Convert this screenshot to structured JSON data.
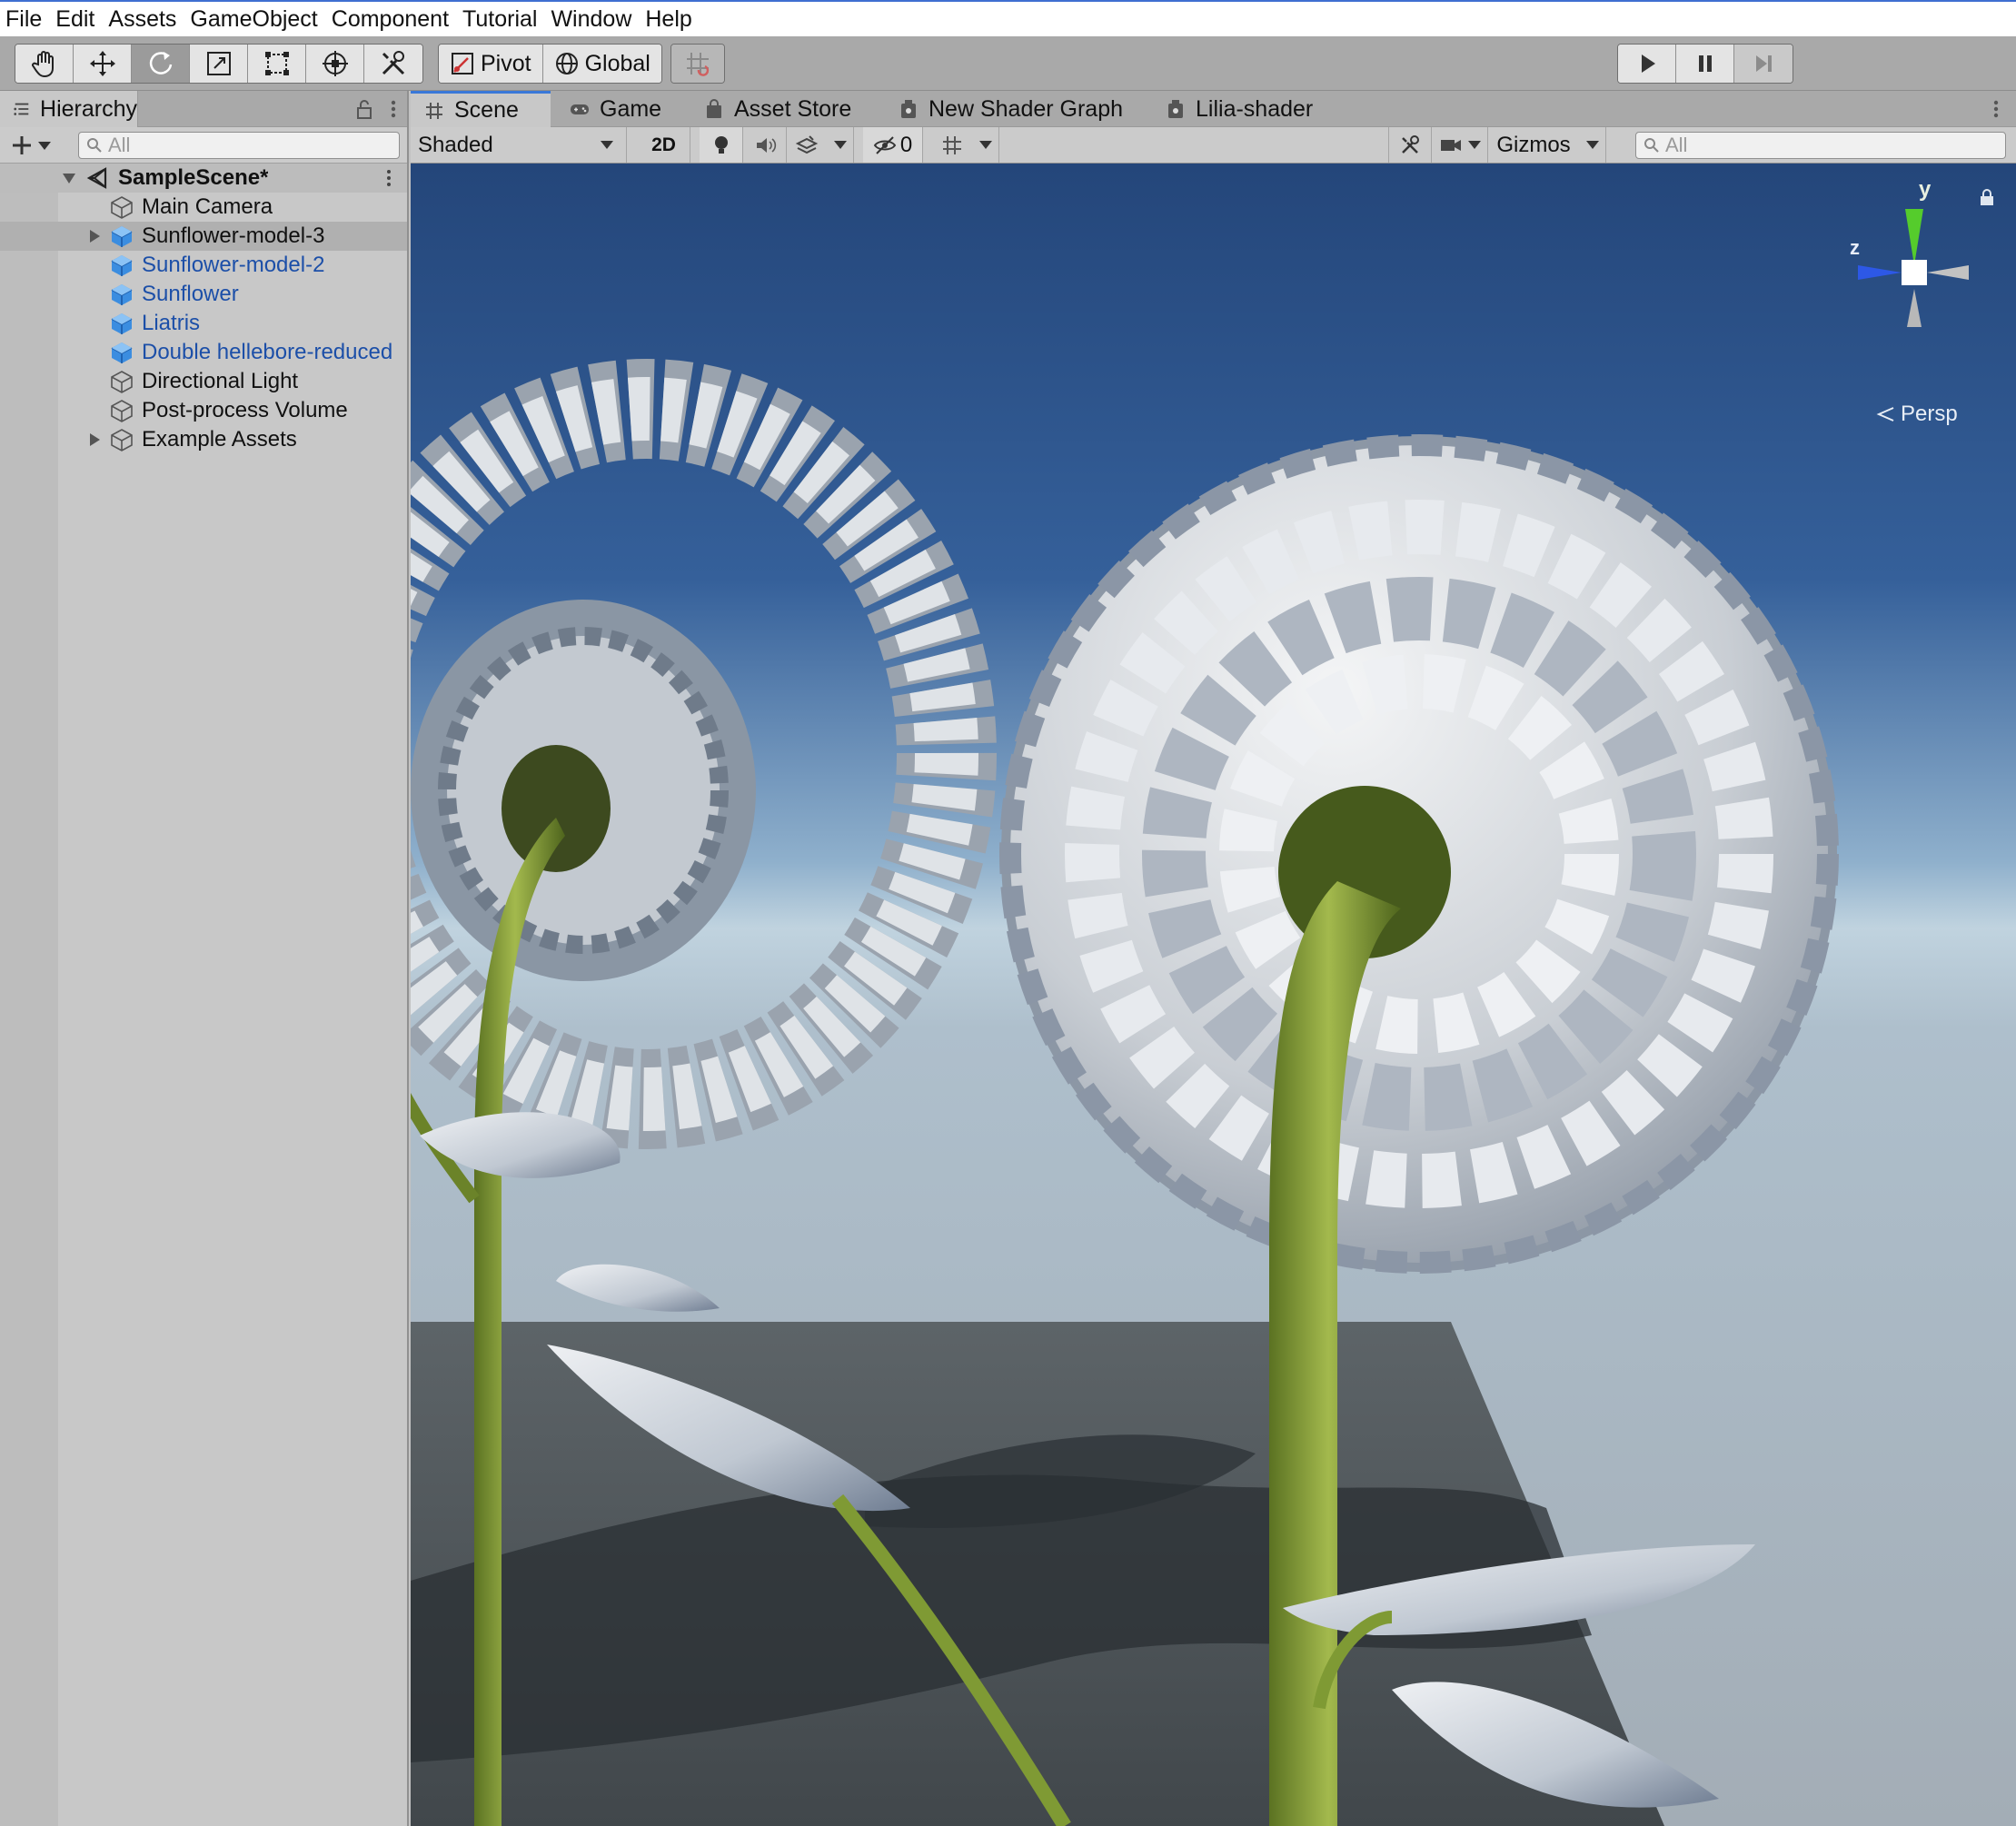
{
  "menu": [
    "File",
    "Edit",
    "Assets",
    "GameObject",
    "Component",
    "Tutorial",
    "Window",
    "Help"
  ],
  "toolbar": {
    "tools": [
      "hand-tool",
      "move-tool",
      "rotate-tool",
      "scale-tool",
      "rect-tool",
      "transform-tool",
      "custom-tool"
    ],
    "active_tool": "rotate-tool",
    "pivot_label": "Pivot",
    "global_label": "Global",
    "play_buttons": [
      "play",
      "pause",
      "step"
    ]
  },
  "hierarchy": {
    "tab_label": "Hierarchy",
    "search_placeholder": "All",
    "scene_name": "SampleScene*",
    "items": [
      {
        "label": "Main Camera",
        "prefab": false,
        "expandable": false
      },
      {
        "label": "Sunflower-model-3",
        "prefab": true,
        "expandable": true
      },
      {
        "label": "Sunflower-model-2",
        "prefab": true,
        "expandable": false
      },
      {
        "label": "Sunflower",
        "prefab": true,
        "expandable": false
      },
      {
        "label": "Liatris",
        "prefab": true,
        "expandable": false
      },
      {
        "label": "Double hellebore-reduced",
        "prefab": true,
        "expandable": false
      },
      {
        "label": "Directional Light",
        "prefab": false,
        "expandable": false
      },
      {
        "label": "Post-process Volume",
        "prefab": false,
        "expandable": false
      },
      {
        "label": "Example Assets",
        "prefab": false,
        "expandable": true
      }
    ]
  },
  "scene_tabs": [
    {
      "label": "Scene",
      "icon": "grid-icon"
    },
    {
      "label": "Game",
      "icon": "gamepad-icon"
    },
    {
      "label": "Asset Store",
      "icon": "shopping-bag-icon"
    },
    {
      "label": "New Shader Graph",
      "icon": "shader-graph-icon"
    },
    {
      "label": "Lilia-shader",
      "icon": "shader-graph-icon"
    }
  ],
  "scene_toolbar": {
    "draw_mode": "Shaded",
    "mode_2d": "2D",
    "hidden_count": "0",
    "gizmos_label": "Gizmos",
    "search_placeholder": "All"
  },
  "viewport": {
    "gizmo_y": "y",
    "gizmo_z": "z",
    "projection": "Persp"
  },
  "colors": {
    "prefab_text": "#1c4fa8",
    "active_tab_accent": "#3a78d8",
    "sky_top": "#26497a",
    "sky_horizon": "#b4c8d8",
    "stem": "#7f9a34"
  }
}
